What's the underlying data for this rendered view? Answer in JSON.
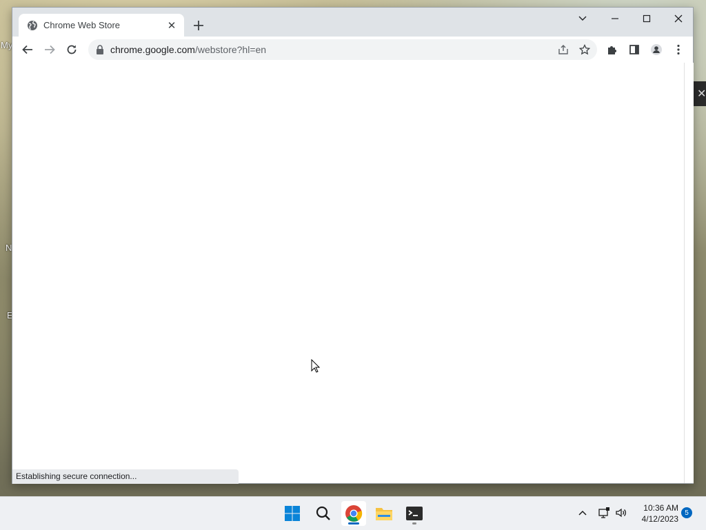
{
  "desktop": {
    "labels": [
      "My",
      "N",
      "E"
    ]
  },
  "browser": {
    "tab": {
      "title": "Chrome Web Store"
    },
    "omnibox": {
      "url_host": "chrome.google.com",
      "url_path": "/webstore?hl=en"
    },
    "status_text": "Establishing secure connection...",
    "icons": {
      "favicon": "globe-icon",
      "back": "arrow-left-icon",
      "forward": "arrow-right-icon",
      "reload": "reload-icon",
      "lock": "lock-icon",
      "share": "share-icon",
      "bookmark": "star-icon",
      "extensions": "puzzle-icon",
      "side_panel": "side-panel-icon",
      "profile": "profile-icon",
      "menu": "kebab-menu-icon"
    }
  },
  "taskbar": {
    "apps": [
      "Start",
      "Search",
      "Google Chrome",
      "File Explorer",
      "Terminal"
    ],
    "clock": {
      "time": "10:36 AM",
      "date": "4/12/2023"
    },
    "notification_count": "5"
  },
  "colors": {
    "accent": "#0067c0",
    "chrome_tab_strip": "#dfe3e7",
    "omnibox_bg": "#f1f3f4"
  }
}
